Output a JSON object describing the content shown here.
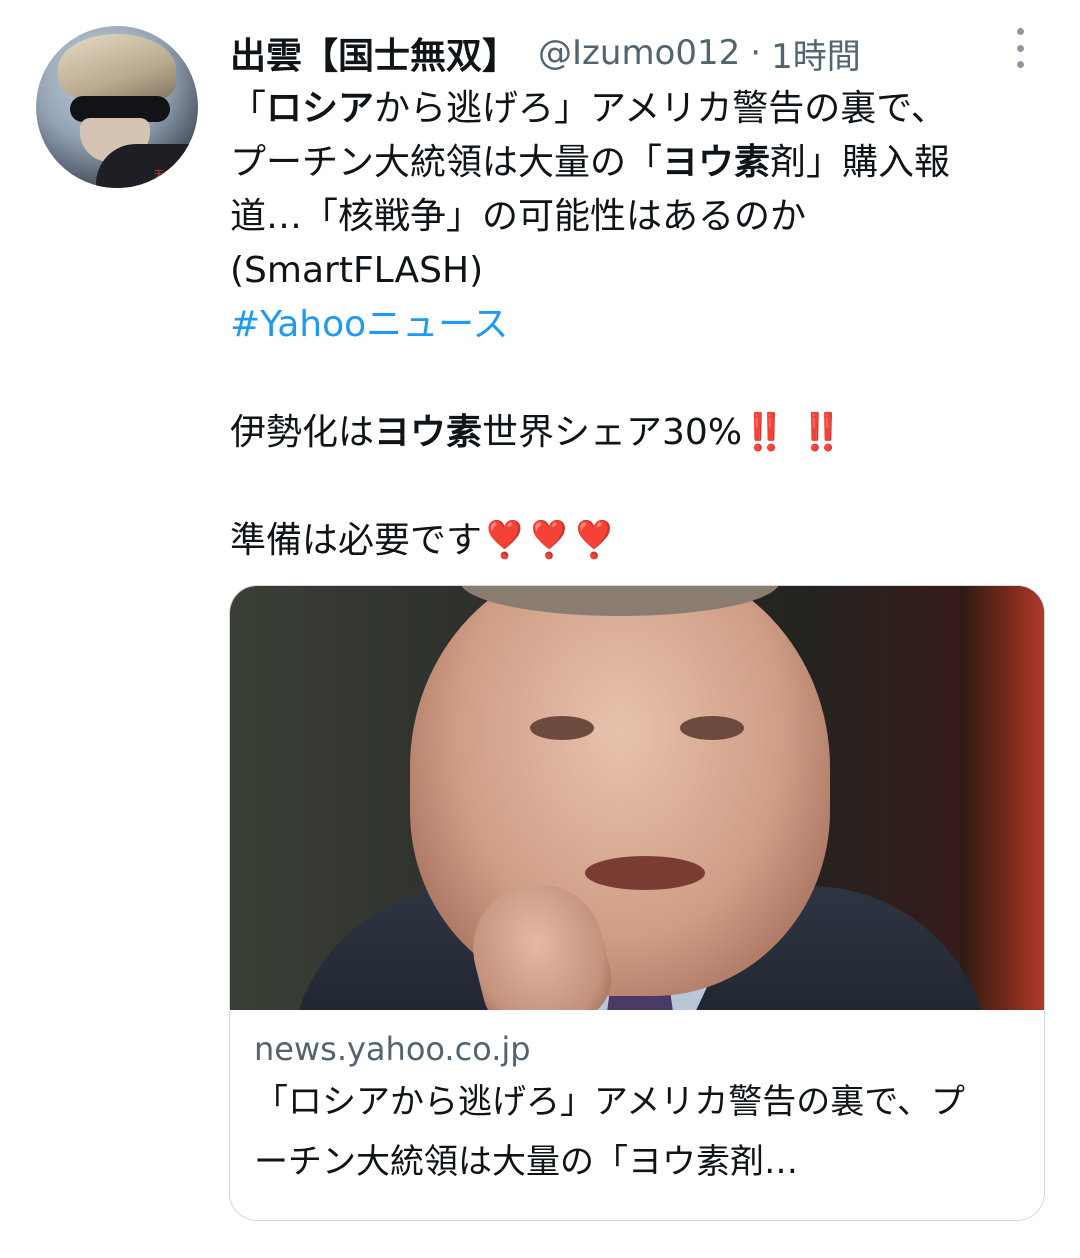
{
  "tweet": {
    "display_name": "出雲【国士無双】",
    "handle": "@Izumo012",
    "separator": "·",
    "time": "1時間",
    "body": {
      "line1_q_open": "「",
      "line1_bold": "ロシア",
      "line1_rest": "から逃げろ」アメリカ警告の裏で、",
      "line2_pre": "プーチン大統領は大量の「",
      "line2_bold": "ヨウ素",
      "line2_post": "剤」購入報",
      "line3": "道…「核戦争」の可能性はあるのか",
      "line4": "(SmartFLASH)",
      "hashtag": "#Yahooニュース",
      "line6_pre": "伊勢化は",
      "line6_bold": "ヨウ素",
      "line6_post": "世界シェア30%",
      "line6_emoji": "‼️ ‼️",
      "line7": "準備は必要です",
      "line7_emoji": "❣️❣️❣️"
    },
    "more_icon": "more-vertical-icon"
  },
  "card": {
    "domain": "news.yahoo.co.jp",
    "title": "「ロシアから逃げろ」アメリカ警告の裏で、プーチン大統領は大量の「ヨウ素剤…"
  },
  "colors": {
    "text": "#0f1419",
    "secondary": "#536471",
    "link": "#1d9bf0",
    "border": "#cfd9de",
    "emoji_red": "#e0245e"
  }
}
